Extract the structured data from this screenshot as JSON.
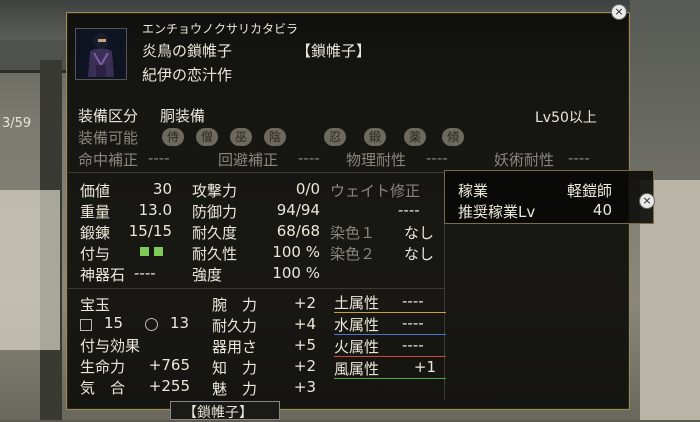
{
  "background": {
    "counter": "3/59"
  },
  "item": {
    "reading": "エンチョウノクサリカタビラ",
    "name": "炎鳥の鎖帷子",
    "category_tag": "【鎖帷子】",
    "subtitle": "紀伊の恋汁作",
    "equip_slot_label": "装備区分",
    "equip_slot_value": "胴装備",
    "level_req": "Lv50以上",
    "equippable_label": "装備可能",
    "classes": [
      "侍",
      "僧",
      "巫",
      "陰",
      "忍",
      "鍛",
      "薬",
      "傾"
    ],
    "modifiers": [
      {
        "label": "命中補正",
        "value": "----"
      },
      {
        "label": "回避補正",
        "value": "----"
      },
      {
        "label": "物理耐性",
        "value": "----"
      },
      {
        "label": "妖術耐性",
        "value": "----"
      }
    ]
  },
  "stats_left": [
    {
      "label": "価値",
      "value": "30"
    },
    {
      "label": "重量",
      "value": "13.0"
    },
    {
      "label": "鍛錬",
      "value": "15/15"
    },
    {
      "label": "付与",
      "value": ""
    },
    {
      "label": "神器石",
      "value": "----"
    }
  ],
  "stats_mid": [
    {
      "label": "攻撃力",
      "value": "0/0"
    },
    {
      "label": "防御力",
      "value": "94/94"
    },
    {
      "label": "耐久度",
      "value": "68/68"
    },
    {
      "label": "耐久性",
      "value": "100 %"
    },
    {
      "label": "強度",
      "value": "100 %"
    }
  ],
  "stats_right": {
    "weight_label": "ウェイト修正",
    "weight_value": "----",
    "dye1_label": "染色１",
    "dye1_value": "なし",
    "dye2_label": "染色２",
    "dye2_value": "なし"
  },
  "gems": {
    "label": "宝玉",
    "square_count": "15",
    "circle_count": "13",
    "effects_label": "付与効果",
    "effects": [
      {
        "label": "生命力",
        "value": "+765"
      },
      {
        "label": "気　合",
        "value": "+255"
      }
    ]
  },
  "attributes": [
    {
      "label": "腕　力",
      "value": "+2"
    },
    {
      "label": "耐久力",
      "value": "+4"
    },
    {
      "label": "器用さ",
      "value": "+5"
    },
    {
      "label": "知　力",
      "value": "+2"
    },
    {
      "label": "魅　力",
      "value": "+3"
    }
  ],
  "elements": [
    {
      "label": "土属性",
      "value": "----",
      "color": "#c8a040"
    },
    {
      "label": "水属性",
      "value": "----",
      "color": "#4a78c8"
    },
    {
      "label": "火属性",
      "value": "----",
      "color": "#c84a3a"
    },
    {
      "label": "風属性",
      "value": "+1",
      "color": "#4aa84a"
    }
  ],
  "job_panel": {
    "job_label": "稼業",
    "job_value": "軽鎧師",
    "rec_label": "推奨稼業Lv",
    "rec_value": "40"
  },
  "bottom_tab": "【鎖帷子】",
  "close_glyph": "×"
}
